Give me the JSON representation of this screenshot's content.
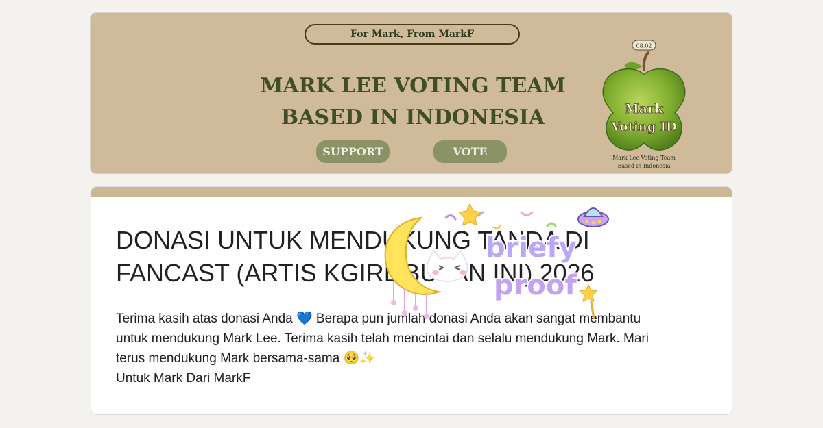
{
  "banner": {
    "tagline": "For Mark, From MarkF",
    "title_line1": "MARK LEE VOTING TEAM",
    "title_line2": "BASED IN INDONESIA",
    "support_label": "SUPPORT",
    "vote_label": "VOTE",
    "logo": {
      "date": "08.02",
      "name_line1": "Mark",
      "name_line2": "Voting ID",
      "caption_line1": "Mark Lee Voting Team",
      "caption_line2": "Based in Indonesia"
    },
    "color": "#cfba9a"
  },
  "form": {
    "title": "DONASI UNTUK MENDUKUNG TANDA DI FANCAST (ARTIS KGIRL BULAN INI) 2026",
    "description_line1": "Terima kasih atas donasi Anda 💙 Berapa pun jumlah donasi Anda akan sangat membantu",
    "description_line2": "untuk mendukung Mark Lee. Terima kasih telah mencintai dan selalu mendukung Mark. Mari",
    "description_line3": "terus mendukung Mark bersama-sama 🥺✨",
    "description_line4": "Untuk Mark Dari MarkF",
    "accent": "#c8b894"
  },
  "sticker": {
    "line1": "briefy",
    "line2": "proof",
    "icons": [
      "moon-icon",
      "cat-icon",
      "star-icon",
      "ufo-icon"
    ]
  }
}
